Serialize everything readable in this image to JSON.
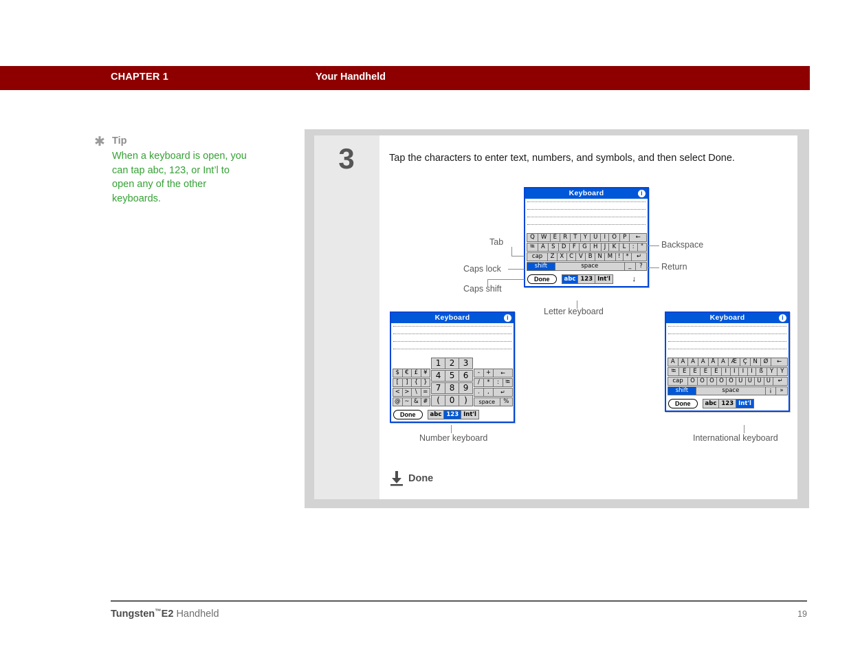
{
  "header": {
    "chapter": "CHAPTER 1",
    "title": "Your Handheld"
  },
  "tip": {
    "icon": "asterisk-icon",
    "title": "Tip",
    "body": "When a keyboard is open, you can tap abc, 123, or Int’l to open any of the other keyboards."
  },
  "step": {
    "number": "3",
    "text": "Tap the characters to enter text, numbers, and symbols, and then select Done."
  },
  "done_footer": {
    "label": "Done",
    "icon": "download-arrow-icon"
  },
  "footer": {
    "brand": "Tungsten",
    "tm": "™",
    "model": "E2",
    "product": "Handheld",
    "page": "19"
  },
  "callouts": {
    "tab": "Tab",
    "caps_lock": "Caps lock",
    "caps_shift": "Caps shift",
    "backspace": "Backspace",
    "return": "Return"
  },
  "captions": {
    "letter": "Letter keyboard",
    "number": "Number keyboard",
    "international": "International keyboard"
  },
  "colors": {
    "header_bar": "#8e0000",
    "tip_text": "#35a135",
    "tip_title": "#8c8c8c",
    "panel_outer": "#d3d3d3",
    "panel_inner": "#ffffff",
    "step_col": "#e9e9e9",
    "kb_blue": "#0057d8",
    "kb_key": "#d4d4d4"
  },
  "keyboards": {
    "letter": {
      "title": "Keyboard",
      "info_icon": "info-icon",
      "rows": [
        [
          "Q",
          "W",
          "E",
          "R",
          "T",
          "Y",
          "U",
          "I",
          "O",
          "P",
          "←"
        ],
        [
          "⭾",
          "A",
          "S",
          "D",
          "F",
          "G",
          "H",
          "J",
          "K",
          "L",
          ":",
          "\""
        ],
        [
          "cap",
          "Z",
          "X",
          "C",
          "V",
          "B",
          "N",
          "M",
          "!",
          "*",
          "↵"
        ],
        [
          "shift",
          "space",
          "_",
          "?"
        ]
      ],
      "done": "Done",
      "modes": [
        "abc",
        "123",
        "Int'l"
      ],
      "selected_mode": "abc",
      "drag_icon": "↓"
    },
    "number": {
      "title": "Keyboard",
      "info_icon": "info-icon",
      "left_rows": [
        [
          "$",
          "€",
          "£",
          "¥"
        ],
        [
          "[",
          "]",
          "{",
          "}"
        ],
        [
          "<",
          ">",
          "\\",
          "="
        ],
        [
          "@",
          "~",
          "&",
          "#"
        ]
      ],
      "mid_rows": [
        [
          "1",
          "2",
          "3"
        ],
        [
          "4",
          "5",
          "6"
        ],
        [
          "7",
          "8",
          "9"
        ],
        [
          "(",
          "0",
          ")"
        ]
      ],
      "right_rows": [
        [
          "-",
          "+",
          "←"
        ],
        [
          "/",
          "*",
          ":",
          "⭾"
        ],
        [
          ".",
          ",",
          "↵"
        ],
        [
          "space",
          "%"
        ]
      ],
      "done": "Done",
      "modes": [
        "abc",
        "123",
        "Int'l"
      ],
      "selected_mode": "123"
    },
    "international": {
      "title": "Keyboard",
      "info_icon": "info-icon",
      "rows": [
        [
          "Á",
          "À",
          "Ä",
          "Ã",
          "Å",
          "Â",
          "Æ",
          "Ç",
          "Ñ",
          "Ø",
          "←"
        ],
        [
          "⭾",
          "É",
          "È",
          "Ē",
          "Ê",
          "Í",
          "Ì",
          "Ï",
          "Î",
          "ß",
          "Ý",
          "Ÿ"
        ],
        [
          "cap",
          "Ó",
          "Ò",
          "Ō",
          "Ô",
          "Õ",
          "Ú",
          "Ù",
          "Ü",
          "Û",
          "↵"
        ],
        [
          "shift",
          "space",
          "¡",
          "»"
        ]
      ],
      "done": "Done",
      "modes": [
        "abc",
        "123",
        "Int'l"
      ],
      "selected_mode": "Int'l"
    }
  }
}
